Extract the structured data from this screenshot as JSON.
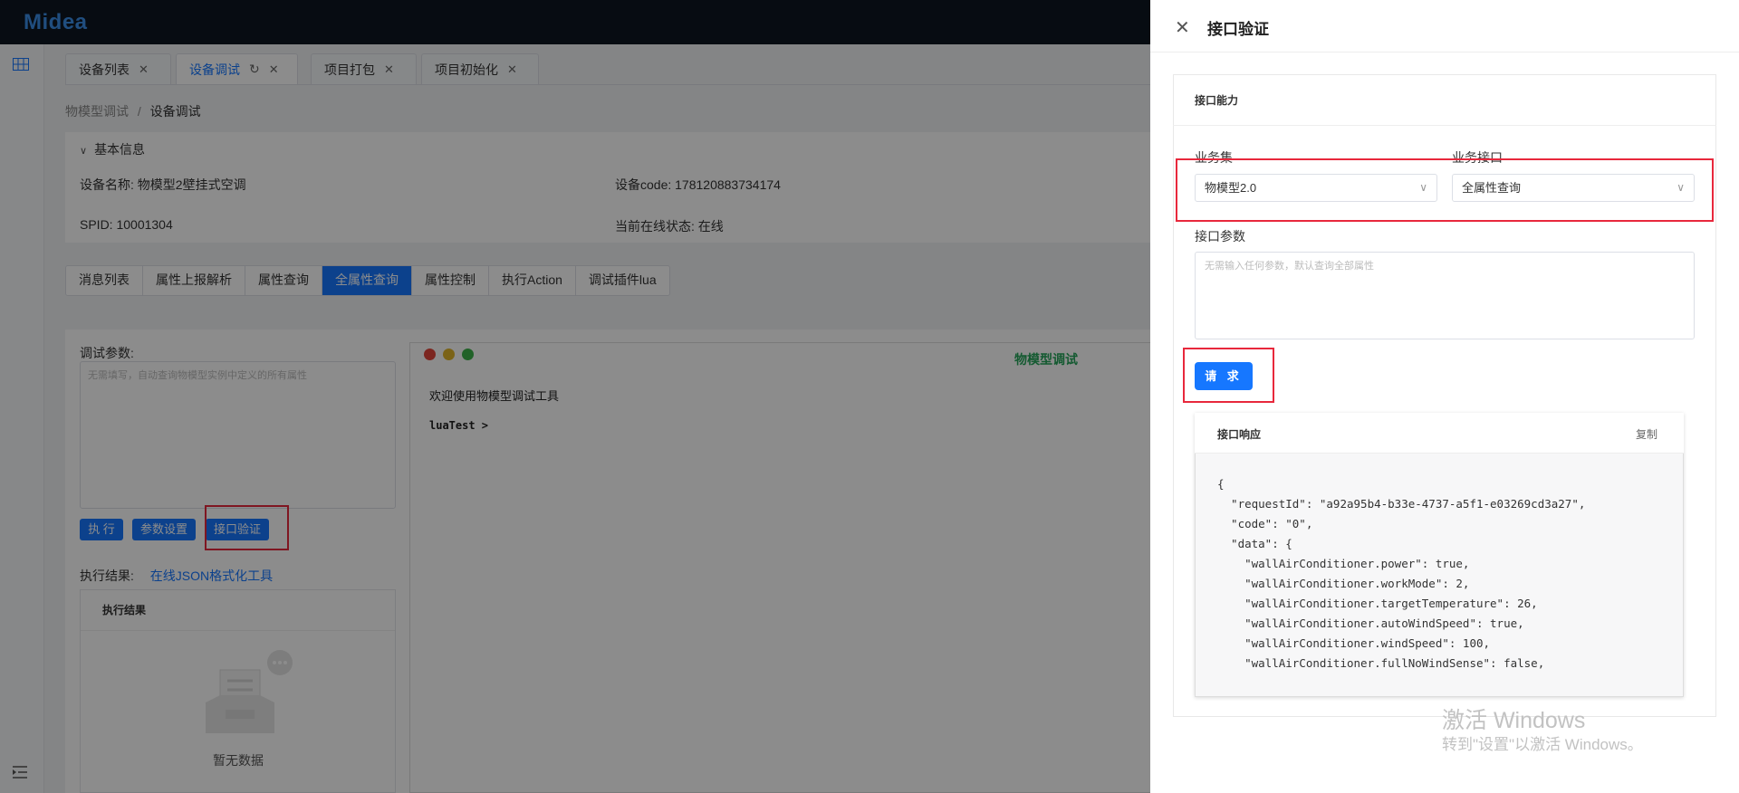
{
  "app": {
    "logo_text": "Midea"
  },
  "tabs": [
    {
      "label": "设备列表"
    },
    {
      "label": "设备调试"
    },
    {
      "label": "项目打包"
    },
    {
      "label": "项目初始化"
    }
  ],
  "breadcrumb": {
    "parent": "物模型调试",
    "sep": "/",
    "current": "设备调试"
  },
  "basic_info": {
    "title": "基本信息",
    "device_name": "设备名称: 物模型2壁挂式空调",
    "device_code": "设备code: 178120883734174",
    "spid": "SPID: 10001304",
    "online_status": "当前在线状态: 在线"
  },
  "sub_tabs": [
    "消息列表",
    "属性上报解析",
    "属性查询",
    "全属性查询",
    "属性控制",
    "执行Action",
    "调试插件lua"
  ],
  "debug": {
    "params_label": "调试参数:",
    "params_placeholder": "无需填写，自动查询物模型实例中定义的所有属性",
    "btn_execute": "执 行",
    "btn_settings": "参数设置",
    "btn_verify": "接口验证",
    "result_label": "执行结果:",
    "json_tool_link": "在线JSON格式化工具",
    "result_card_title": "执行结果",
    "empty_text": "暂无数据"
  },
  "terminal": {
    "title": "物模型调试",
    "welcome": "欢迎使用物模型调试工具",
    "prompt": "luaTest >"
  },
  "drawer": {
    "title": "接口验证",
    "capability_title": "接口能力",
    "service_set_label": "业务集",
    "service_set_value": "物模型2.0",
    "service_api_label": "业务接口",
    "service_api_value": "全属性查询",
    "params_label": "接口参数",
    "params_placeholder": "无需输入任何参数，默认查询全部属性",
    "request_button": "请 求",
    "response_title": "接口响应",
    "copy_label": "复制",
    "response_code": "{\n  \"requestId\": \"a92a95b4-b33e-4737-a5f1-e03269cd3a27\",\n  \"code\": \"0\",\n  \"data\": {\n    \"wallAirConditioner.power\": true,\n    \"wallAirConditioner.workMode\": 2,\n    \"wallAirConditioner.targetTemperature\": 26,\n    \"wallAirConditioner.autoWindSpeed\": true,\n    \"wallAirConditioner.windSpeed\": 100,\n    \"wallAirConditioner.fullNoWindSense\": false,"
  },
  "watermark": {
    "line1": "激活 Windows",
    "line2": "转到\"设置\"以激活 Windows。"
  },
  "colors": {
    "accent": "#1677ff",
    "highlight_box": "#e8283c",
    "terminal_title": "#25a55a"
  }
}
